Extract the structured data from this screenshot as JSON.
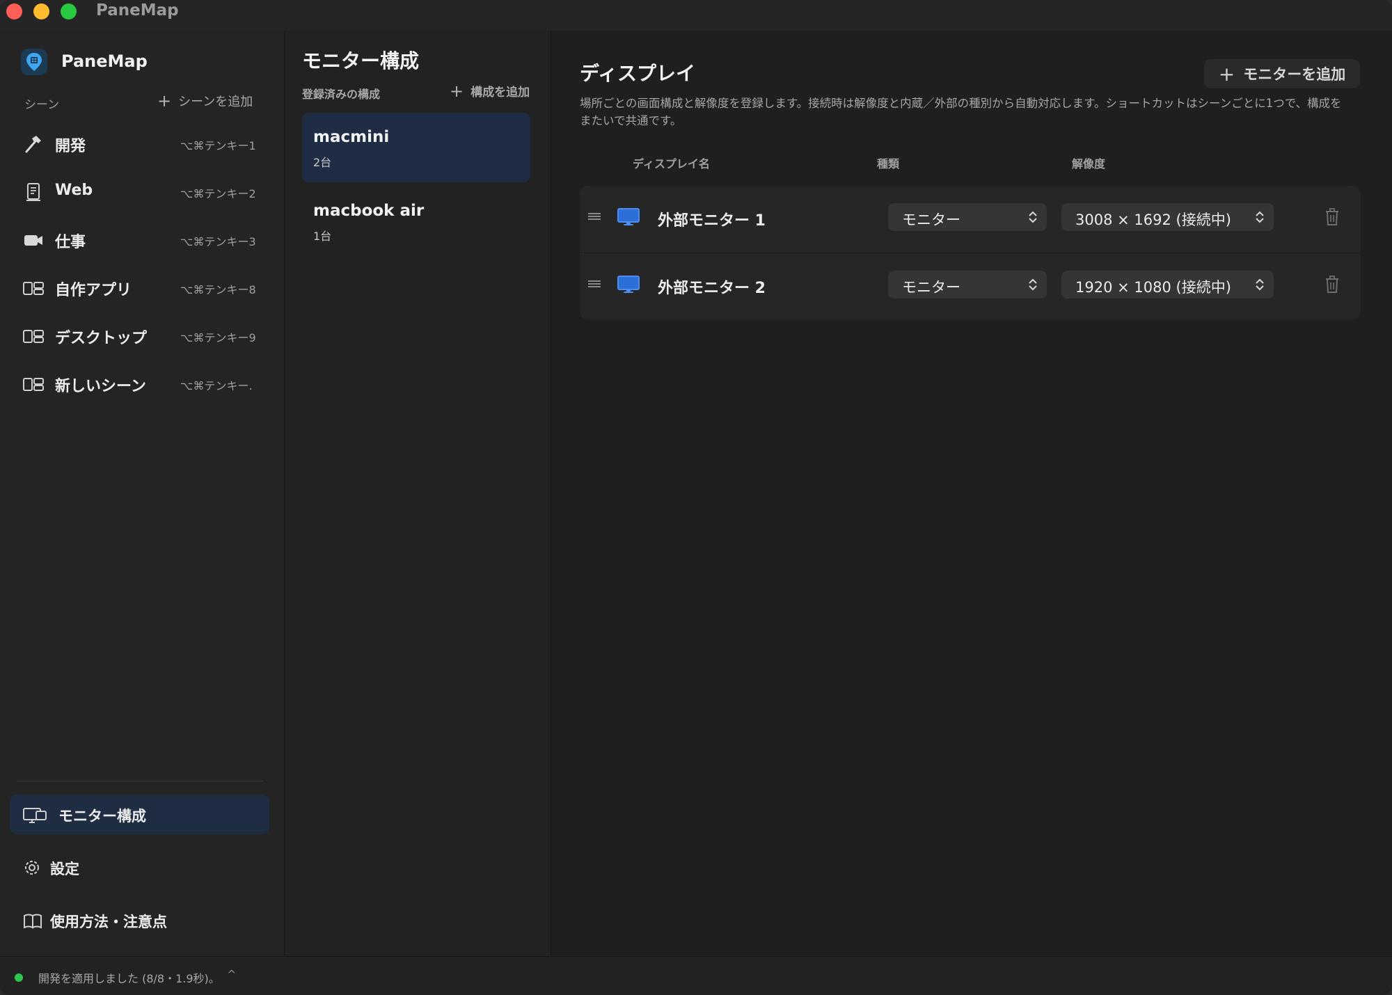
{
  "window": {
    "title": "PaneMap"
  },
  "sidebar": {
    "app_name": "PaneMap",
    "section_label": "シーン",
    "add_scene_label": "シーンを追加",
    "scenes": [
      {
        "label": "開発",
        "shortcut": "⌥⌘テンキー1",
        "icon": "hammer-icon"
      },
      {
        "label": "Web",
        "shortcut": "⌥⌘テンキー2",
        "icon": "document-icon"
      },
      {
        "label": "仕事",
        "shortcut": "⌥⌘テンキー3",
        "icon": "video-camera-icon"
      },
      {
        "label": "自作アプリ",
        "shortcut": "⌥⌘テンキー8",
        "icon": "split-window-icon"
      },
      {
        "label": "デスクトップ",
        "shortcut": "⌥⌘テンキー9",
        "icon": "split-window-icon"
      },
      {
        "label": "新しいシーン",
        "shortcut": "⌥⌘テンキー.",
        "icon": "split-window-icon"
      }
    ],
    "nav": [
      {
        "label": "モニター構成",
        "icon": "displays-icon",
        "active": true
      },
      {
        "label": "設定",
        "icon": "gear-icon",
        "active": false
      },
      {
        "label": "使用方法・注意点",
        "icon": "book-icon",
        "active": false
      }
    ]
  },
  "configs_panel": {
    "title": "モニター構成",
    "subtitle": "登録済みの構成",
    "add_label": "構成を追加",
    "items": [
      {
        "name": "macmini",
        "count": "2台",
        "selected": true
      },
      {
        "name": "macbook air",
        "count": "1台",
        "selected": false
      }
    ]
  },
  "display_panel": {
    "title": "ディスプレイ",
    "add_button": "モニターを追加",
    "description": "場所ごとの画面構成と解像度を登録します。接続時は解像度と内蔵／外部の種別から自動対応します。ショートカットはシーンごとに1つで、構成をまたいで共通です。",
    "columns": {
      "name": "ディスプレイ名",
      "type": "種類",
      "resolution": "解像度"
    },
    "rows": [
      {
        "name": "外部モニター 1",
        "type": "モニター",
        "resolution": "3008 × 1692 (接続中)"
      },
      {
        "name": "外部モニター 2",
        "type": "モニター",
        "resolution": "1920 × 1080 (接続中)"
      }
    ]
  },
  "status": {
    "text": "開発を適用しました (8/8・1.9秒)。",
    "indicator_color": "#2fc64d"
  },
  "colors": {
    "accent": "#2d7cf6",
    "selected_bg": "#1f2d44"
  }
}
